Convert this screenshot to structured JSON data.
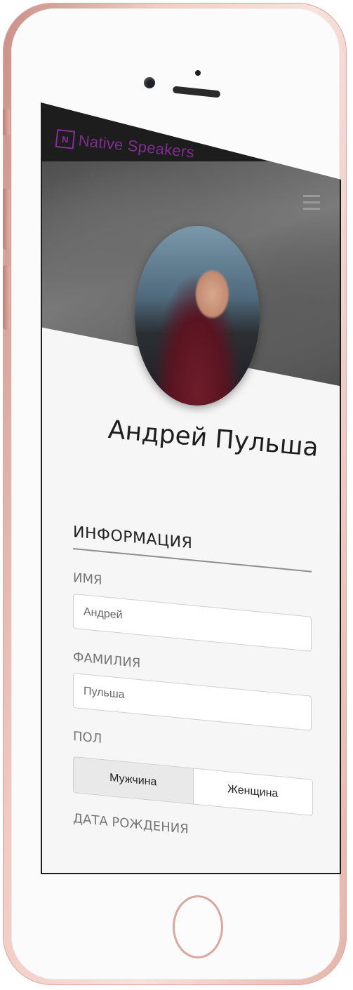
{
  "app": {
    "brand_logo_letter": "N",
    "brand_name": "Native Speakers"
  },
  "profile": {
    "name": "Андрей Пульша"
  },
  "form": {
    "section_title": "ИНФОРМАЦИЯ",
    "first_name_label": "ИМЯ",
    "first_name_value": "Андрей",
    "last_name_label": "ФАМИЛИЯ",
    "last_name_value": "Пульша",
    "gender_label": "ПОЛ",
    "gender_options": [
      "Мужчина",
      "Женщина"
    ],
    "gender_selected": "Мужчина",
    "birthdate_label": "ДАТА РОЖДЕНИЯ"
  },
  "colors": {
    "brand": "#7e2f8e",
    "navbar_bg": "#1d1d1d",
    "phone_body": "#f1cdc4"
  },
  "icons": [
    "hamburger-menu-icon"
  ]
}
